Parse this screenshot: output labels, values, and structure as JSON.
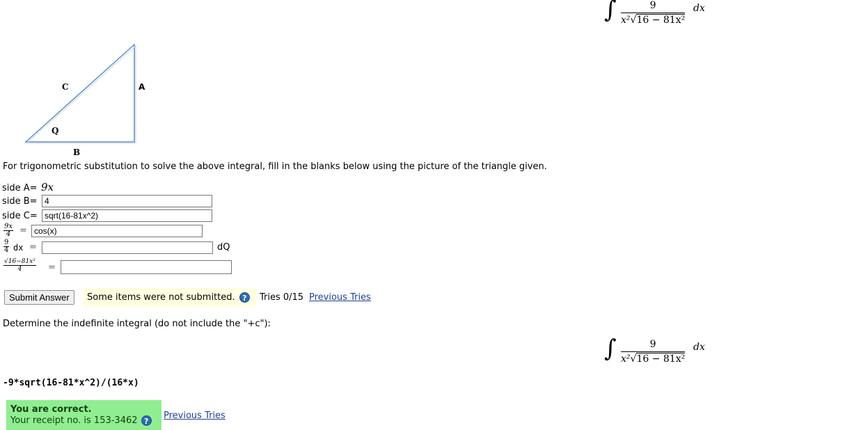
{
  "integral": {
    "numerator": "9",
    "denominator_x2": "x²",
    "sqrt_sign": "√",
    "radicand": "16 − 81x²",
    "differential": "dx",
    "sign": "∫"
  },
  "triangle": {
    "label_c": "C",
    "label_a": "A",
    "label_q": "Q",
    "label_b": "B"
  },
  "instruction": "For trigonometric substitution to solve the above integral, fill in the blanks below using the picture of the triangle given.",
  "form": {
    "side_a_label": "side A=",
    "side_a_value": "9x",
    "side_b_label": "side B=",
    "side_b_value": "4",
    "side_c_label": "side C=",
    "side_c_value": "sqrt(16-81x^2)",
    "frac1_num": "9x",
    "frac1_den": "4",
    "eq": "=",
    "row4_value": "cos(x)",
    "frac2_num": "9",
    "frac2_den": "4",
    "dx_label": "dx",
    "row5_value": "",
    "dq_label": "dQ",
    "frac3_num": "√16−81x²",
    "frac3_den": "4",
    "row6_value": ""
  },
  "submit": {
    "button_label": "Submit Answer",
    "status_text": "Some items were not submitted.",
    "help_icon": "?",
    "tries_text": "Tries 0/15",
    "previous_tries": "Previous Tries"
  },
  "part2": {
    "prompt": "Determine the indefinite integral (do not include the \"+c\"):",
    "answer": "-9*sqrt(16-81*x^2)/(16*x)",
    "correct_title": "You are correct.",
    "receipt": "Your receipt no. is 153-3462",
    "help_icon": "?",
    "previous_tries": "Previous Tries"
  },
  "colors": {
    "correct_bg": "#90ee90",
    "status_bg": "#ffffe0",
    "link": "#1f3f9a",
    "triangle_stroke": "#5b8cc4"
  }
}
